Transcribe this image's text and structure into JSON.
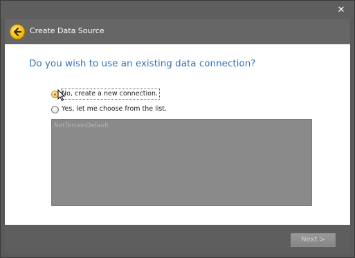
{
  "window": {
    "close_glyph": "✕"
  },
  "header": {
    "title": "Create Data Source",
    "back_icon": "back-arrow-icon"
  },
  "main": {
    "question": "Do you wish to use an existing data connection?",
    "options": [
      {
        "label": "No, create a new connection.",
        "selected": true
      },
      {
        "label": "Yes, let me choose from the list.",
        "selected": false
      }
    ],
    "connection_list": {
      "items": [
        "NetTerrainDefault"
      ],
      "enabled": false
    }
  },
  "footer": {
    "next_label": "Next >",
    "next_enabled": false
  },
  "colors": {
    "accent_title": "#2e73b8",
    "chrome": "#5e5e5e",
    "back_button": "#f5c21a"
  }
}
